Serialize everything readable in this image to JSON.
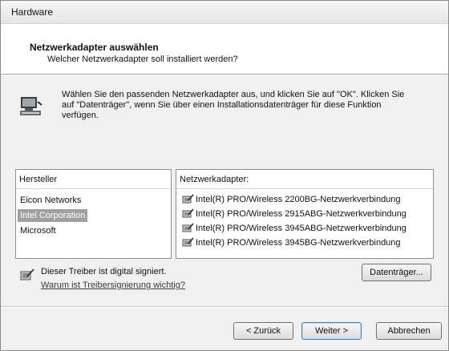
{
  "window": {
    "title": "Hardware"
  },
  "header": {
    "title": "Netzwerkadapter auswählen",
    "subtitle": "Welcher Netzwerkadapter soll installiert werden?"
  },
  "info": {
    "icon": "computer-network-icon",
    "line1": "Wählen Sie den passenden Netzwerkadapter aus, und klicken Sie auf \"OK\". Klicken Sie",
    "line2": "auf \"Datenträger\", wenn Sie über einen Installationsdatenträger für diese Funktion",
    "line3": "verfügen."
  },
  "manufacturer_list": {
    "header": "Hersteller",
    "items": [
      "Eicon Networks",
      "Intel Corporation",
      "Microsoft"
    ],
    "selected": "Intel Corporation"
  },
  "adapter_list": {
    "header": "Netzwerkadapter:",
    "items": [
      "Intel(R) PRO/Wireless 2200BG-Netzwerkverbindung",
      "Intel(R) PRO/Wireless 2915ABG-Netzwerkverbindung",
      "Intel(R) PRO/Wireless 3945ABG-Netzwerkverbindung",
      "Intel(R) PRO/Wireless 3945BG-Netzwerkverbindung"
    ],
    "item_icon": "signed-driver-icon"
  },
  "signature": {
    "text": "Dieser Treiber ist digital signiert.",
    "link": "Warum ist Treibersignierung wichtig?",
    "icon": "signed-driver-icon"
  },
  "buttons": {
    "disk": "Datenträger...",
    "back": "< Zurück",
    "next": "Weiter >",
    "cancel": "Abbrechen"
  }
}
